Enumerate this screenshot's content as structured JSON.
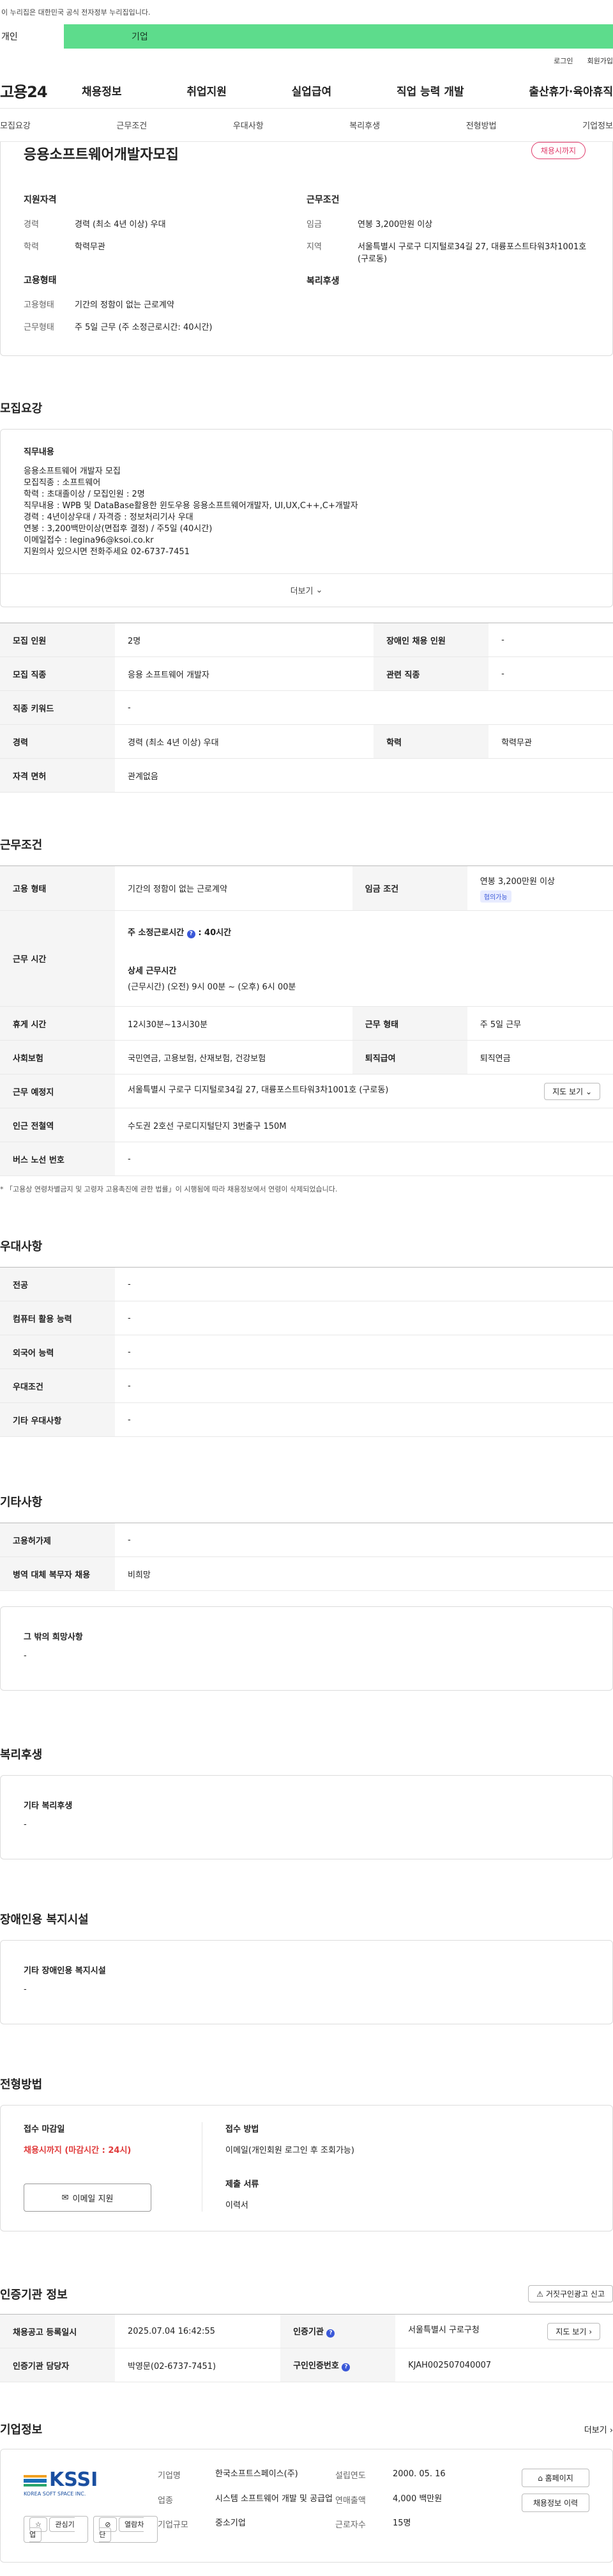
{
  "gov_notice": "이 누리집은 대한민국 공식 전자정부 누리집입니다.",
  "type_tabs": [
    "개인",
    "기업"
  ],
  "util_links": [
    "로그인",
    "회원가입"
  ],
  "logo": "고용24",
  "gnb": [
    "채용정보",
    "취업지원",
    "실업급여",
    "직업 능력 개발",
    "출산휴가·육아휴직"
  ],
  "subnav": [
    "모집요강",
    "근무조건",
    "우대사항",
    "복리후생",
    "전형방법",
    "기업정보"
  ],
  "summary": {
    "title": "응용소프트웨어개발자모집",
    "badge": "채용시까지",
    "qual_h": "지원자격",
    "qual": [
      {
        "k": "경력",
        "v": "경력 (최소 4년 이상) 우대"
      },
      {
        "k": "학력",
        "v": "학력무관"
      }
    ],
    "emp_h": "고용형태",
    "emp": [
      {
        "k": "고용형태",
        "v": "기간의 정함이 없는 근로계약"
      },
      {
        "k": "근무형태",
        "v": "주 5일 근무 (주 소정근로시간: 40시간)"
      }
    ],
    "cond_h": "근무조건",
    "cond": [
      {
        "k": "임금",
        "v": "연봉 3,200만원 이상"
      },
      {
        "k": "지역",
        "v": "서울특별시 구로구 디지털로34길 27, 대륭포스트타워3차1001호 (구로동)"
      }
    ],
    "welfare_h": "복리후생"
  },
  "recruit": {
    "title": "모집요강",
    "detail_h": "직무내용",
    "lines": [
      "응용소프트웨어 개발자 모집",
      "모집직종 : 소프트웨어",
      "학력 : 초대졸이상 / 모집인원 : 2명",
      "직무내용 : WPB 및 DataBase활용한 윈도우용 응용소프트웨어개발자, UI,UX,C++,C+개발자",
      "경력 : 4년이상우대 / 자격증 : 정보처리기사 우대",
      "연봉 : 3,200백만이상(면접후 결정) / 주5일 (40시간)",
      "이메일접수 : legina96@ksoi.co.kr",
      "지원의사 있으시면 전화주세요 02-6737-7451"
    ],
    "more": "더보기",
    "table": [
      [
        "모집 인원",
        "2명",
        "장애인 채용 인원",
        "-"
      ],
      [
        "모집 직종",
        "응용 소프트웨어 개발자",
        "관련 직종",
        "-"
      ],
      [
        "직종 키워드",
        "-"
      ],
      [
        "경력",
        "경력 (최소 4년 이상) 우대",
        "학력",
        "학력무관"
      ],
      [
        "자격 면허",
        "관계없음"
      ]
    ]
  },
  "cond": {
    "title": "근무조건",
    "emp_k": "고용 형태",
    "emp_v": "기간의 정함이 없는 근로계약",
    "wage_k": "임금 조건",
    "wage_v": "연봉 3,200만원 이상",
    "wage_tag": "협의가능",
    "hours_k": "근무 시간",
    "hours_v1": "주 소정근로시간",
    "hours_v1b": ": 40시간",
    "hours_v2": "상세 근무시간",
    "hours_v3": "(근무시간) (오전) 9시 00분 ~ (오후) 6시 00분",
    "break_k": "휴게 시간",
    "break_v": "12시30분~13시30분",
    "shift_k": "근무 형태",
    "shift_v": "주 5일 근무",
    "ins_k": "사회보험",
    "ins_v": "국민연금, 고용보험, 산재보험, 건강보험",
    "ret_k": "퇴직급여",
    "ret_v": "퇴직연금",
    "place_k": "근무 예정지",
    "place_v": "서울특별시 구로구 디지털로34길 27, 대륭포스트타워3차1001호 (구로동)",
    "map_btn": "지도 보기",
    "subway_k": "인근 전철역",
    "subway_v": "수도권 2호선 구로디지털단지 3번출구 150M",
    "bus_k": "버스 노선 번호",
    "bus_v": "-",
    "note": "* 「고용상 연령차별금지 및 고령자 고용촉진에 관한 법률」이 시행됨에 따라 채용정보에서 연령이 삭제되었습니다."
  },
  "pref": {
    "title": "우대사항",
    "rows": [
      [
        "전공",
        "-"
      ],
      [
        "컴퓨터 활용 능력",
        "-"
      ],
      [
        "외국어 능력",
        "-"
      ],
      [
        "우대조건",
        "-"
      ],
      [
        "기타 우대사항",
        "-"
      ]
    ]
  },
  "etc": {
    "title": "기타사항",
    "rows": [
      [
        "고용허가제",
        "-"
      ],
      [
        "병역 대체 복무자 채용",
        "비희망"
      ]
    ],
    "box_h": "그 밖의 희망사항",
    "box_v": "-"
  },
  "welfare": {
    "title": "복리후생",
    "h": "기타 복리후생",
    "v": "-"
  },
  "disab": {
    "title": "장애인용 복지시설",
    "h": "기타 장애인용 복지시설",
    "v": "-"
  },
  "apply": {
    "title": "전형방법",
    "deadline_h": "접수 마감일",
    "deadline_v": "채용시까지 (마감시간 : 24시)",
    "mail_btn": "이메일 지원",
    "method_h": "접수 방법",
    "method_v": "이메일(개인회원 로그인 후 조회가능)",
    "docs_h": "제출 서류",
    "docs_v": "이력서"
  },
  "cert": {
    "title": "인증기관 정보",
    "report_btn": "거짓구인광고 신고",
    "rows": [
      [
        "채용공고 등록일시",
        "2025.07.04 16:42:55",
        "인증기관",
        "서울특별시 구로구청"
      ],
      [
        "인증기관 담당자",
        "박영문(02-6737-7451)",
        "구인인증번호",
        "KJAH002507040007"
      ]
    ],
    "map_btn": "지도 보기"
  },
  "company": {
    "title": "기업정보",
    "more": "더보기",
    "logo_text": "KSSI",
    "logo_sub": "KOREA SOFT SPACE INC.",
    "fav_btn": "관심기업",
    "block_btn": "열람차단",
    "items": [
      {
        "k": "기업명",
        "v": "한국소프트스페이스(주)"
      },
      {
        "k": "설립연도",
        "v": "2000. 05. 16"
      },
      {
        "k": "업종",
        "v": "시스템 소프트웨어 개발 및 공급업"
      },
      {
        "k": "연매출액",
        "v": "4,000 백만원"
      },
      {
        "k": "기업규모",
        "v": "중소기업"
      },
      {
        "k": "근로자수",
        "v": "15명"
      }
    ],
    "home_btn": "홈페이지",
    "jobs_btn": "채용정보 이력"
  }
}
